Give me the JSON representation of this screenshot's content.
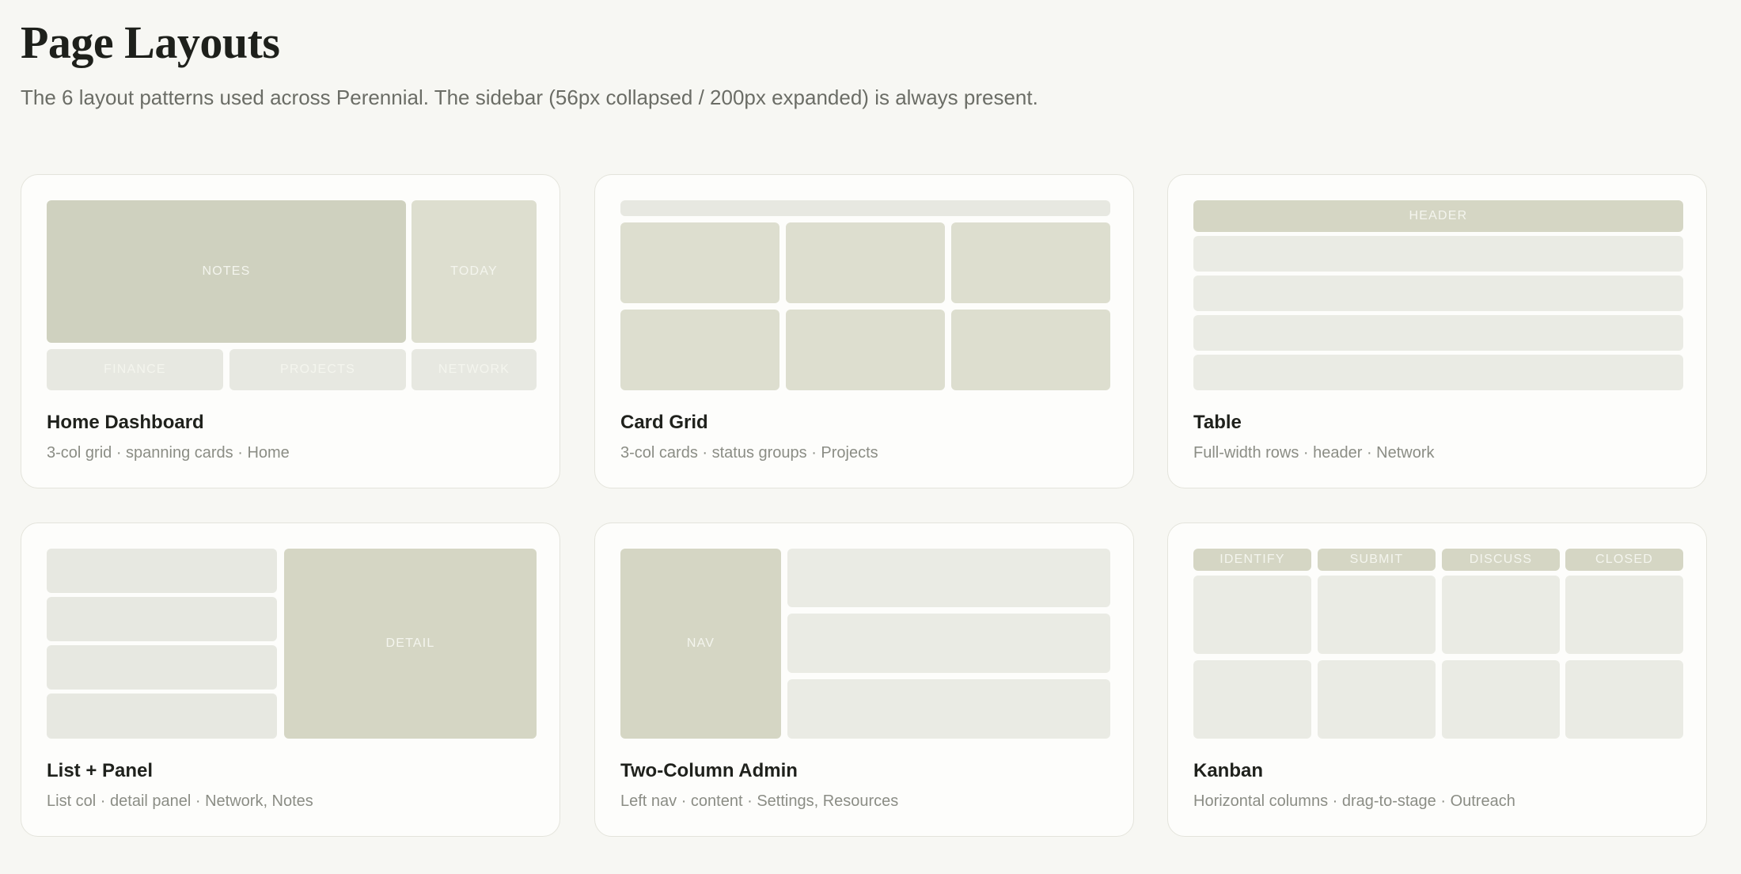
{
  "header": {
    "title": "Page Layouts",
    "subtitle": "The 6 layout patterns used across Perennial. The sidebar (56px collapsed / 200px expanded) is always present."
  },
  "cards": [
    {
      "title": "Home Dashboard",
      "description": "3-col grid · spanning cards · Home",
      "labels": {
        "notes": "NOTES",
        "today": "TODAY",
        "finance": "FINANCE",
        "projects": "PROJECTS",
        "network": "NETWORK"
      }
    },
    {
      "title": "Card Grid",
      "description": "3-col cards · status groups · Projects"
    },
    {
      "title": "Table",
      "description": "Full-width rows · header · Network",
      "labels": {
        "header": "HEADER"
      }
    },
    {
      "title": "List + Panel",
      "description": "List col · detail panel · Network, Notes",
      "labels": {
        "detail": "DETAIL"
      }
    },
    {
      "title": "Two-Column Admin",
      "description": "Left nav · content · Settings, Resources",
      "labels": {
        "nav": "NAV"
      }
    },
    {
      "title": "Kanban",
      "description": "Horizontal columns · drag-to-stage · Outreach",
      "labels": {
        "identify": "IDENTIFY",
        "submit": "SUBMIT",
        "discuss": "DISCUSS",
        "closed": "CLOSED"
      }
    }
  ]
}
